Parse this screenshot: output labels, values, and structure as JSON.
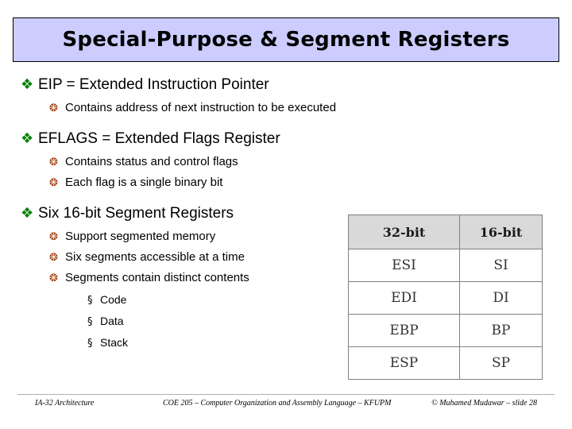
{
  "slide": {
    "title": "Special-Purpose & Segment Registers",
    "title_bg": "#ccccff",
    "bullets": {
      "b1": "EIP =  Extended Instruction Pointer",
      "b1s1": "Contains address of next instruction to be executed",
      "b2": "EFLAGS = Extended Flags Register",
      "b2s1": "Contains status and control flags",
      "b2s2": "Each flag is a single binary bit",
      "b3": "Six 16-bit Segment Registers",
      "b3s1": "Support segmented memory",
      "b3s2": "Six segments accessible at a time",
      "b3s3": "Segments contain distinct contents",
      "b3s3a": "Code",
      "b3s3b": "Data",
      "b3s3c": "Stack"
    },
    "glyphs": {
      "level1_bullet": "❖",
      "level2_bullet": "❂",
      "level3_bullet": "§"
    },
    "table": {
      "headers": [
        "32-bit",
        "16-bit"
      ],
      "rows": [
        [
          "ESI",
          "SI"
        ],
        [
          "EDI",
          "DI"
        ],
        [
          "EBP",
          "BP"
        ],
        [
          "ESP",
          "SP"
        ]
      ]
    },
    "footer": {
      "left": "IA-32 Architecture",
      "center": "COE 205 – Computer Organization and Assembly Language – KFUPM",
      "right": "© Muhamed Mudawar – slide 28"
    }
  }
}
